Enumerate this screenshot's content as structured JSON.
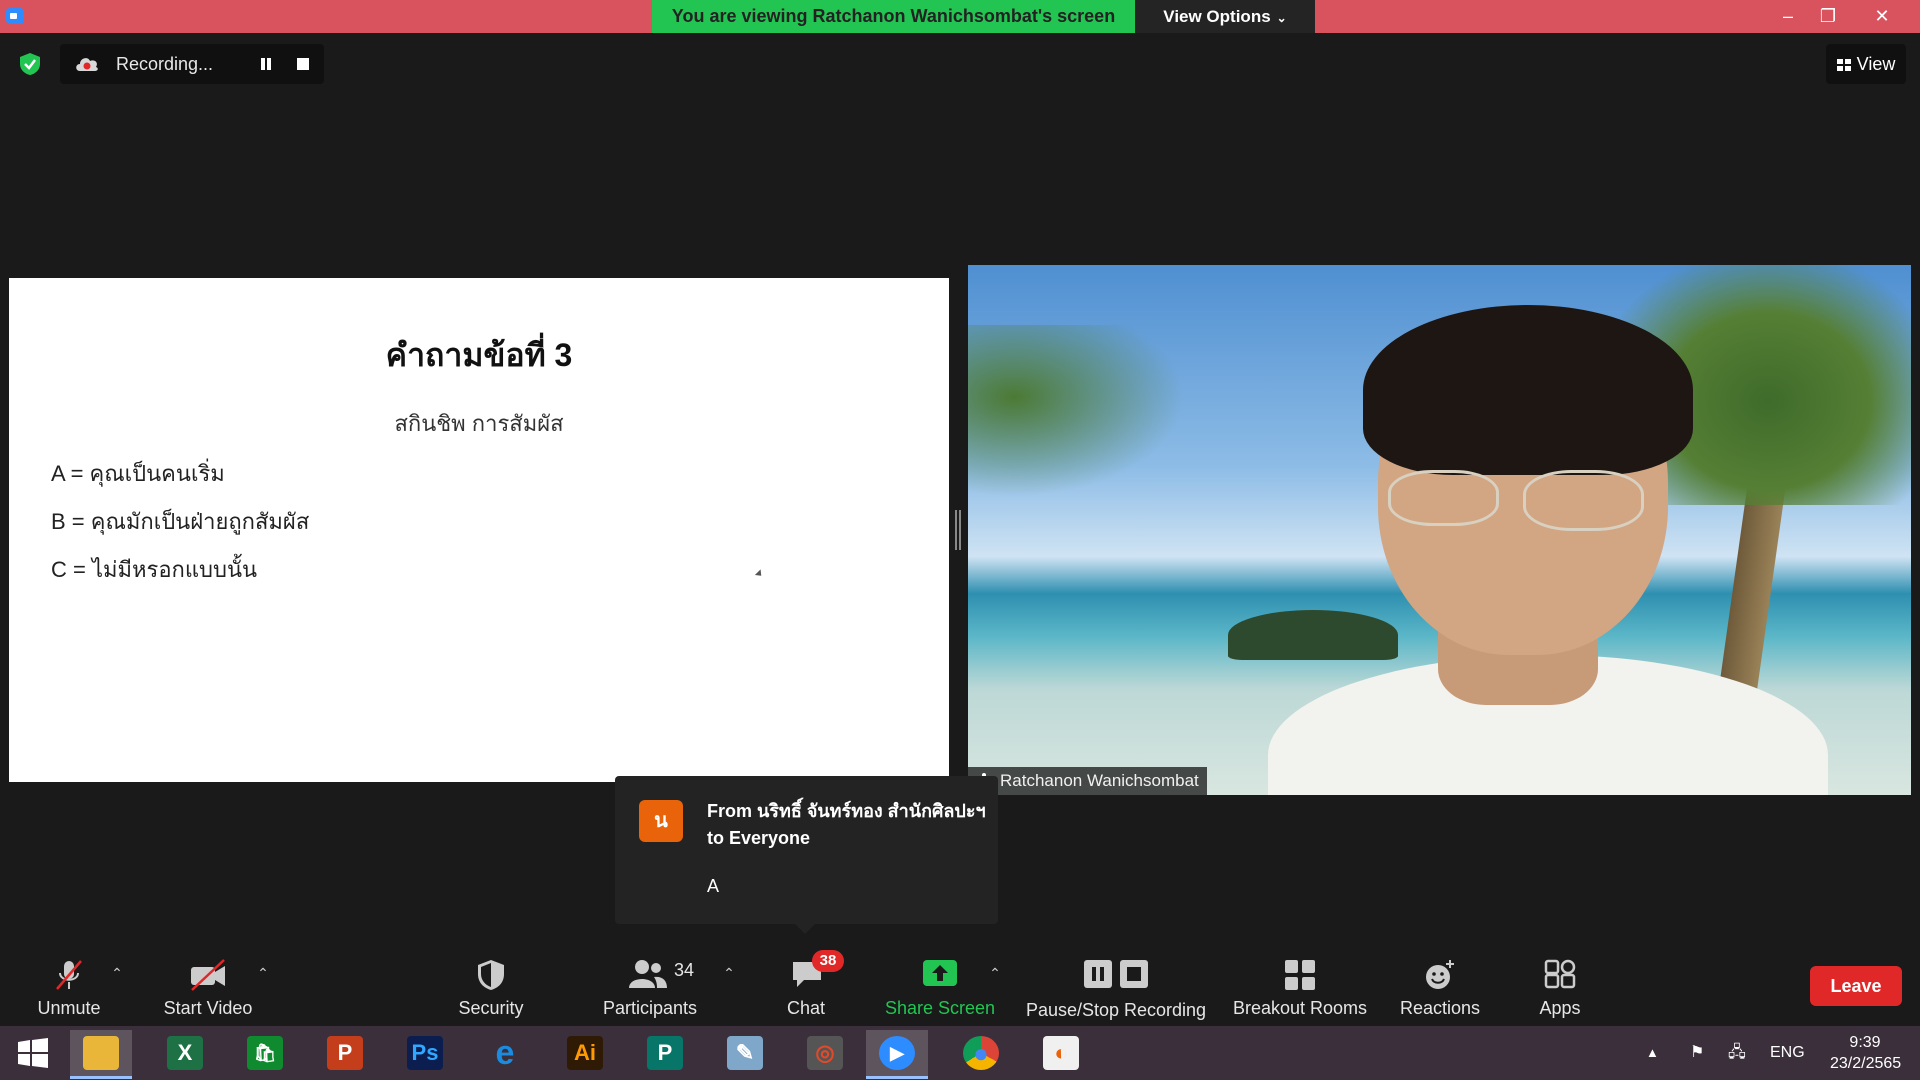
{
  "window": {
    "viewing_banner": "You are viewing Ratchanon Wanichsombat's screen",
    "view_options_label": "View Options",
    "minimize": "–",
    "restore": "❐",
    "close": "✕"
  },
  "recording": {
    "status_text": "Recording...",
    "view_label": "View"
  },
  "slide": {
    "title": "คำถามข้อที่ 3",
    "subtitle": "สกินชิพ การสัมผัส",
    "options": [
      "A = คุณเป็นคนเริ่ม",
      "B = คุณมักเป็นฝ่ายถูกสัมผัส",
      "C = ไม่มีหรอกแบบนั้น"
    ]
  },
  "video": {
    "participant_name": "Ratchanon Wanichsombat"
  },
  "chat_popup": {
    "avatar_letter": "น",
    "from": "From นริทธิ์ จันทร์ทอง สำนักศิลปะฯ to Everyone",
    "message": "A"
  },
  "toolbar": {
    "unmute": "Unmute",
    "start_video": "Start Video",
    "security": "Security",
    "participants": "Participants",
    "participants_count": "34",
    "chat": "Chat",
    "chat_badge": "38",
    "share_screen": "Share Screen",
    "pause_stop_recording": "Pause/Stop Recording",
    "breakout_rooms": "Breakout Rooms",
    "reactions": "Reactions",
    "apps": "Apps",
    "leave": "Leave",
    "share_color": "#23c552",
    "leave_color": "#e02828"
  },
  "taskbar": {
    "apps": [
      {
        "name": "windows-start-icon",
        "glyph": "",
        "color": "transparent"
      },
      {
        "name": "file-explorer-icon",
        "glyph": "",
        "color": "#e9b63a"
      },
      {
        "name": "excel-icon",
        "glyph": "X",
        "color": "#1e7145"
      },
      {
        "name": "store-icon",
        "glyph": "🛍",
        "color": "#0f8a2e"
      },
      {
        "name": "powerpoint-icon",
        "glyph": "P",
        "color": "#c43e1c"
      },
      {
        "name": "photoshop-icon",
        "glyph": "Ps",
        "color": "#0b1e4f"
      },
      {
        "name": "internet-explorer-icon",
        "glyph": "e",
        "color": "#1a8be0"
      },
      {
        "name": "illustrator-icon",
        "glyph": "Ai",
        "color": "#2e1a05"
      },
      {
        "name": "publisher-icon",
        "glyph": "P",
        "color": "#077568"
      },
      {
        "name": "notepad-icon",
        "glyph": "✎",
        "color": "#7fa7c9"
      },
      {
        "name": "photoscape-icon",
        "glyph": "◎",
        "color": "#555555"
      },
      {
        "name": "zoom-icon",
        "glyph": "▶",
        "color": "#2d8cff"
      },
      {
        "name": "chrome-icon",
        "glyph": "●",
        "color": "#3a8bea"
      },
      {
        "name": "paint-icon",
        "glyph": "◐",
        "color": "#f0f0f0"
      }
    ],
    "language": "ENG",
    "time": "9:39",
    "date": "23/2/2565"
  }
}
